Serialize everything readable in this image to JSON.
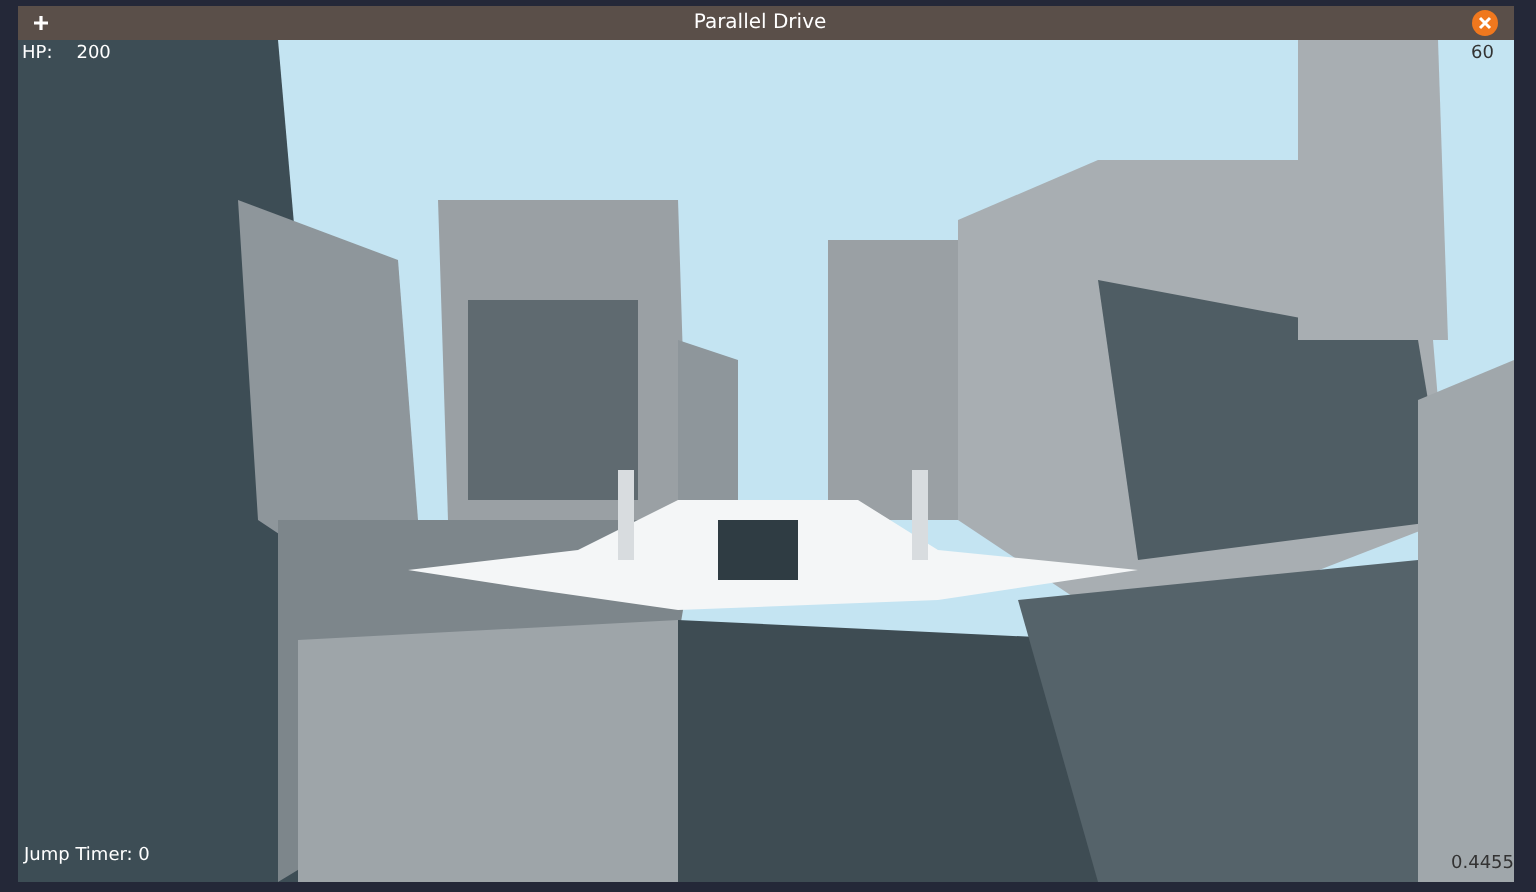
{
  "window": {
    "title": "Parallel Drive"
  },
  "hud": {
    "hp_label": "HP:",
    "hp_value": "200",
    "fps": "60",
    "jump_timer": "Jump Timer: 0",
    "reading": "0.4455"
  }
}
